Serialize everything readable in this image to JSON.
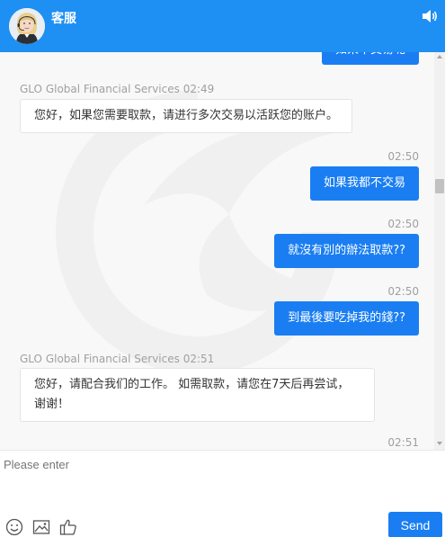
{
  "header": {
    "title": "客服",
    "sound_icon": "speaker-icon",
    "avatar": "agent-avatar"
  },
  "messages": [
    {
      "dir": "out",
      "time": "",
      "text": "如果不交易呢"
    },
    {
      "dir": "in",
      "sender": "GLO Global Financial Services",
      "time": "02:49",
      "text": "您好，如果您需要取款，请进行多次交易以活跃您的账户。"
    },
    {
      "dir": "out",
      "time": "02:50",
      "text": "如果我都不交易"
    },
    {
      "dir": "out",
      "time": "02:50",
      "text": "就沒有別的辦法取款??"
    },
    {
      "dir": "out",
      "time": "02:50",
      "text": "到最後要吃掉我的錢??"
    },
    {
      "dir": "in",
      "sender": "GLO Global Financial Services",
      "time": "02:51",
      "text": "您好，请配合我们的工作。 如需取款，请您在7天后再尝试，谢谢！"
    },
    {
      "dir": "out",
      "time": "02:51",
      "text": ""
    }
  ],
  "input": {
    "placeholder": "Please enter",
    "value": ""
  },
  "toolbar": {
    "emoji_icon": "emoji-icon",
    "image_icon": "image-icon",
    "like_icon": "thumbs-up-icon",
    "send_label": "Send"
  },
  "colors": {
    "header": "#1e8ff3",
    "outgoing_bubble": "#1a7ef2",
    "chat_bg": "#f8f8f9"
  }
}
